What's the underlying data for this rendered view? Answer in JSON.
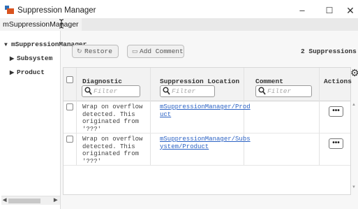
{
  "window": {
    "title": "Suppression Manager",
    "controls": {
      "minimize": "–",
      "maximize": "☐",
      "close": "✕"
    }
  },
  "tabs": [
    {
      "label": "mSuppressionManager",
      "active": true
    }
  ],
  "tree": {
    "root": "mSuppressionManager",
    "children": [
      "Subsystem",
      "Product"
    ]
  },
  "toolbar": {
    "restore_label": "Restore",
    "add_comment_label": "Add Comment",
    "suppression_count": "2 Suppressions"
  },
  "table": {
    "columns": [
      {
        "label": "Diagnostic",
        "filter_placeholder": "Filter"
      },
      {
        "label": "Suppression Location",
        "filter_placeholder": "Filter"
      },
      {
        "label": "Comment",
        "filter_placeholder": "Filter"
      },
      {
        "label": "Actions"
      }
    ],
    "rows": [
      {
        "diagnostic": "Wrap on overflow\ndetected. This\noriginated from\n'???'",
        "location": "mSuppressionManager/Prod\nuct",
        "comment": "",
        "action_label": "•••"
      },
      {
        "diagnostic": "Wrap on overflow\ndetected. This\noriginated from\n'???'",
        "location": "mSuppressionManager/Subs\nystem/Product",
        "comment": "",
        "action_label": "•••"
      }
    ]
  },
  "colors": {
    "link": "#2b62c4",
    "accent_orange": "#d9531e",
    "accent_blue": "#2e6fb7"
  }
}
